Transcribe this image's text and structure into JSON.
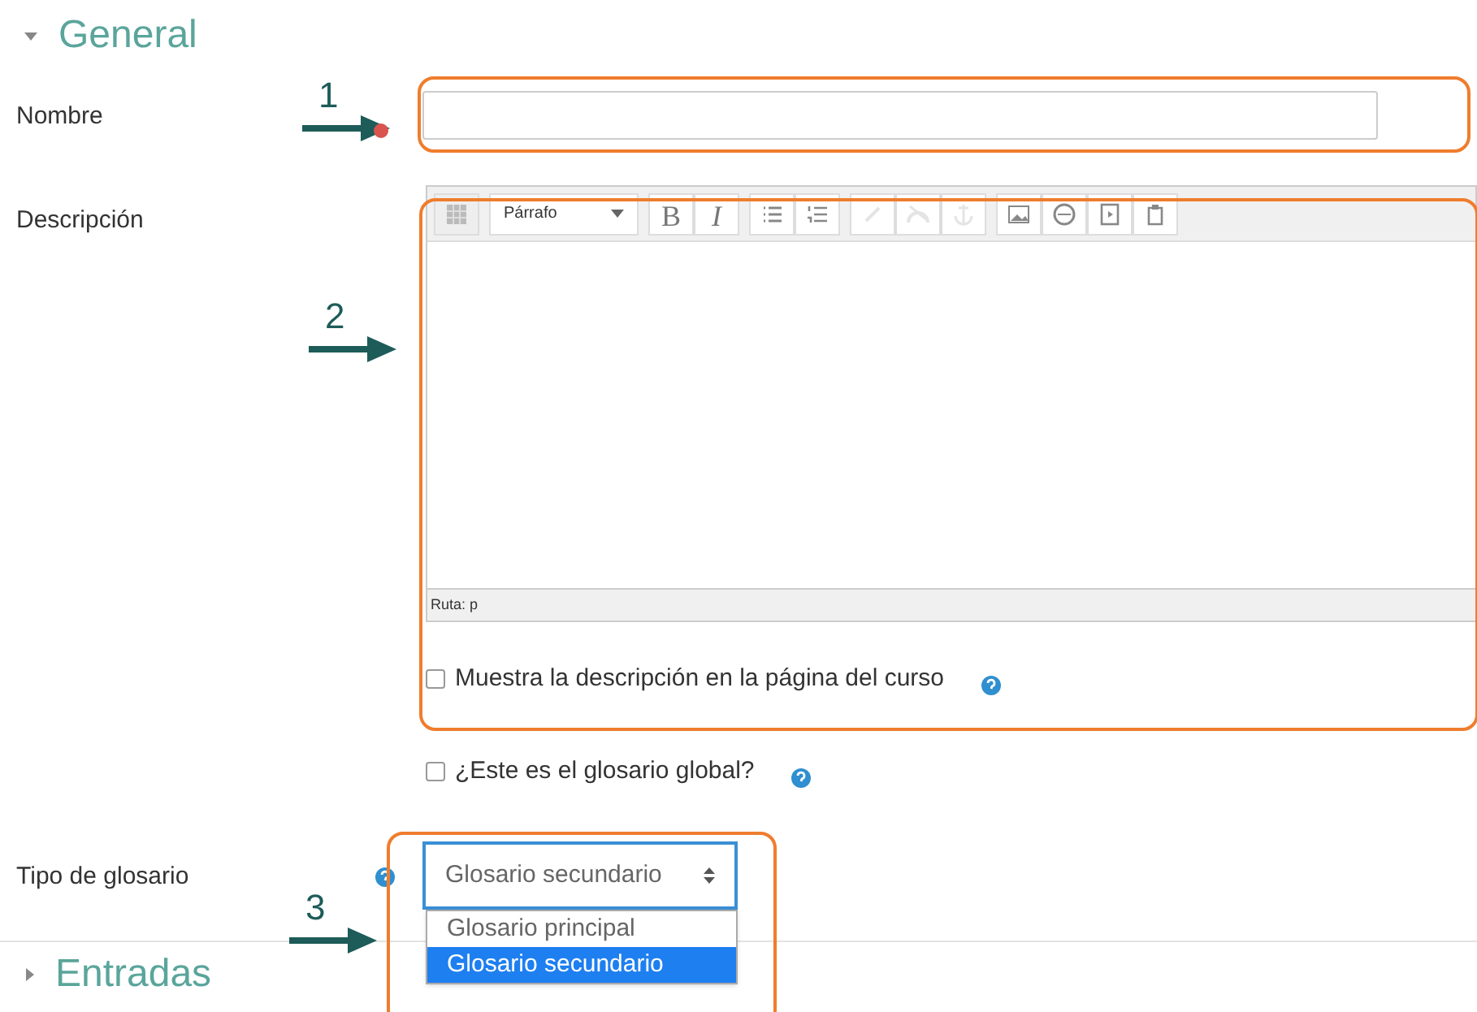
{
  "sections": [
    {
      "title": "General",
      "expanded": true
    },
    {
      "title": "Entradas",
      "expanded": false
    }
  ],
  "name_field": {
    "label": "Nombre",
    "required": true
  },
  "description": {
    "label": "Descripción",
    "format": "Párrafo",
    "toolbar": [
      {
        "kind": "icon"
      },
      {
        "kind": "format"
      },
      {
        "kind": "text",
        "label": "B",
        "disabled": false
      },
      {
        "kind": "text",
        "label": "I",
        "disabled": false
      },
      {
        "kind": "icon",
        "disabled": false
      },
      {
        "kind": "icon",
        "disabled": false
      },
      {
        "kind": "icon",
        "disabled": true
      },
      {
        "kind": "icon",
        "disabled": true
      },
      {
        "kind": "icon",
        "disabled": true
      },
      {
        "kind": "icon",
        "disabled": false
      },
      {
        "kind": "icon",
        "disabled": false
      },
      {
        "kind": "icon",
        "disabled": false
      },
      {
        "kind": "icon",
        "disabled": false
      }
    ],
    "path": "Ruta: p"
  },
  "checkboxes": [
    {
      "label": "Muestra la descripción en la página del curso",
      "checked": false
    },
    {
      "label": "¿Este es el glosario global?",
      "checked": false
    }
  ],
  "glossary_type": {
    "label": "Tipo de glosario",
    "value": "Glosario secundario",
    "options": [
      {
        "label": "Glosario principal",
        "selected": false
      },
      {
        "label": "Glosario secundario",
        "selected": true
      }
    ]
  },
  "annotations": [
    {
      "number": "1"
    },
    {
      "number": "2"
    },
    {
      "number": "3"
    }
  ]
}
